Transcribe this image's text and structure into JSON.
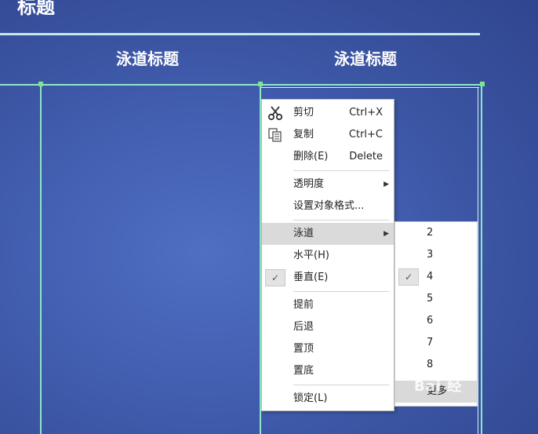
{
  "document": {
    "title": "标题",
    "lane_titles": [
      "泳道标题",
      "泳道标题"
    ]
  },
  "context_menu": {
    "items": [
      {
        "label": "剪切",
        "shortcut": "Ctrl+X",
        "icon": "scissors-icon"
      },
      {
        "label": "复制",
        "shortcut": "Ctrl+C",
        "icon": "copy-icon"
      },
      {
        "label": "删除(E)",
        "shortcut": "Delete"
      },
      {
        "label": "透明度",
        "submenu": true
      },
      {
        "label": "设置对象格式..."
      },
      {
        "label": "泳道",
        "submenu": true,
        "highlighted": true
      },
      {
        "label": "水平(H)"
      },
      {
        "label": "垂直(E)",
        "checked": true
      },
      {
        "label": "提前"
      },
      {
        "label": "后退"
      },
      {
        "label": "置顶"
      },
      {
        "label": "置底"
      },
      {
        "label": "锁定(L)"
      }
    ]
  },
  "lane_submenu": {
    "options": [
      "2",
      "3",
      "4",
      "5",
      "6",
      "7",
      "8"
    ],
    "selected": "4",
    "more_label": "更多"
  },
  "watermark": {
    "text": "Bai 经"
  },
  "colors": {
    "background": "#4562b5",
    "lane_line": "#8fe6c8",
    "handle": "#7de68a",
    "menu_highlight": "#dadada"
  }
}
